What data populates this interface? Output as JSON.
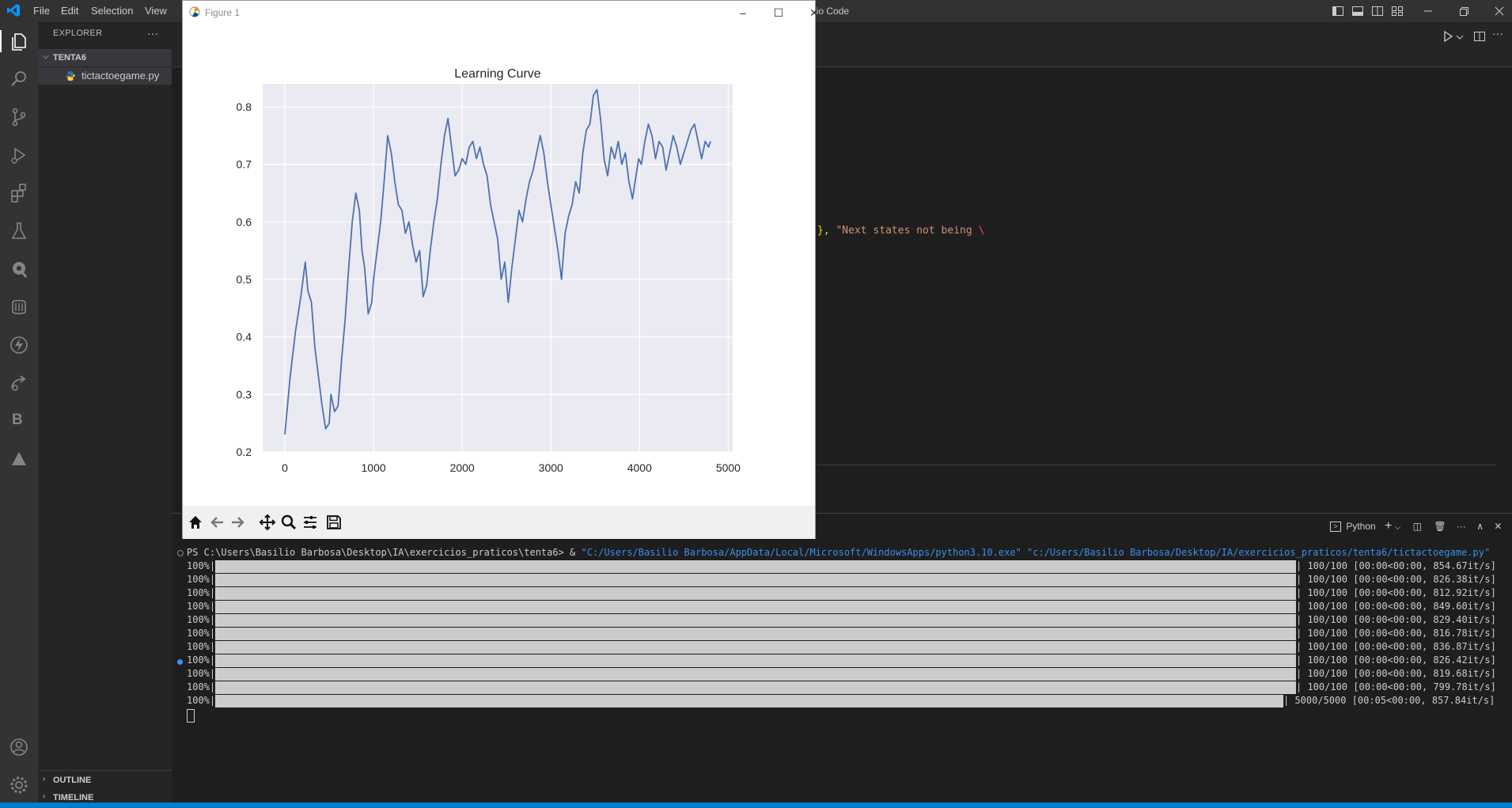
{
  "menu": {
    "file": "File",
    "edit": "Edit",
    "selection": "Selection",
    "view": "View"
  },
  "window": {
    "title_fragment": "dio Code"
  },
  "explorer": {
    "title": "EXPLORER",
    "more": "···",
    "folder": "TENTA6",
    "file": "tictactoegame.py",
    "outline": "OUTLINE",
    "timeline": "TIMELINE"
  },
  "editor": {
    "code_line_punct": "}, ",
    "code_line_string": "\"Next states not being ",
    "code_line_escape": "\\"
  },
  "panel": {
    "python_label": "Python"
  },
  "terminal": {
    "prompt": "PS C:\\Users\\Basilio Barbosa\\Desktop\\IA\\exercicios_praticos\\tenta6> & ",
    "cmd_exe": "\"C:/Users/Basilio Barbosa/AppData/Local/Microsoft/WindowsApps/python3.10.exe\"",
    "cmd_script": "\"c:/Users/Basilio Barbosa/Desktop/IA/exercicios_praticos/tenta6/tictactoegame.py\"",
    "progress": [
      {
        "pct": "100%|",
        "stat": "| 100/100 [00:00<00:00, 854.67it/s]"
      },
      {
        "pct": "100%|",
        "stat": "| 100/100 [00:00<00:00, 826.38it/s]"
      },
      {
        "pct": "100%|",
        "stat": "| 100/100 [00:00<00:00, 812.92it/s]"
      },
      {
        "pct": "100%|",
        "stat": "| 100/100 [00:00<00:00, 849.60it/s]"
      },
      {
        "pct": "100%|",
        "stat": "| 100/100 [00:00<00:00, 829.40it/s]"
      },
      {
        "pct": "100%|",
        "stat": "| 100/100 [00:00<00:00, 816.78it/s]"
      },
      {
        "pct": "100%|",
        "stat": "| 100/100 [00:00<00:00, 836.87it/s]"
      },
      {
        "pct": "100%|",
        "stat": "| 100/100 [00:00<00:00, 826.42it/s]"
      },
      {
        "pct": "100%|",
        "stat": "| 100/100 [00:00<00:00, 819.68it/s]"
      },
      {
        "pct": "100%|",
        "stat": "| 100/100 [00:00<00:00, 799.78it/s]"
      },
      {
        "pct": "100%|",
        "stat": "| 5000/5000 [00:05<00:00, 857.84it/s]"
      }
    ]
  },
  "figure": {
    "window_title": "Figure 1"
  },
  "chart_data": {
    "type": "line",
    "title": "Learning Curve",
    "xlabel": "",
    "ylabel": "",
    "xlim": [
      -250,
      5050
    ],
    "ylim": [
      0.2,
      0.84
    ],
    "xticks": [
      0,
      1000,
      2000,
      3000,
      4000,
      5000
    ],
    "yticks": [
      0.2,
      0.3,
      0.4,
      0.5,
      0.6,
      0.7,
      0.8
    ],
    "xtick_labels": [
      "0",
      "1000",
      "2000",
      "3000",
      "4000",
      "5000"
    ],
    "ytick_labels": [
      "0.2",
      "0.3",
      "0.4",
      "0.5",
      "0.6",
      "0.7",
      "0.8"
    ],
    "grid": true,
    "style": "seaborn-darkgrid",
    "color": "#4c72b0",
    "series": [
      {
        "x": [
          0,
          60,
          120,
          180,
          230,
          260,
          300,
          340,
          380,
          420,
          460,
          500,
          520,
          560,
          600,
          640,
          680,
          720,
          760,
          800,
          840,
          870,
          900,
          940,
          980,
          1000,
          1040,
          1080,
          1120,
          1160,
          1200,
          1240,
          1280,
          1320,
          1360,
          1400,
          1440,
          1480,
          1520,
          1560,
          1600,
          1640,
          1680,
          1720,
          1760,
          1800,
          1840,
          1880,
          1920,
          1960,
          2000,
          2040,
          2080,
          2120,
          2160,
          2200,
          2240,
          2280,
          2320,
          2360,
          2400,
          2440,
          2480,
          2520,
          2560,
          2600,
          2640,
          2680,
          2720,
          2760,
          2800,
          2840,
          2880,
          2920,
          2960,
          3000,
          3040,
          3080,
          3120,
          3160,
          3200,
          3240,
          3280,
          3320,
          3360,
          3400,
          3440,
          3480,
          3520,
          3560,
          3600,
          3640,
          3680,
          3720,
          3760,
          3800,
          3840,
          3880,
          3920,
          3960,
          3990,
          4020,
          4060,
          4100,
          4140,
          4180,
          4220,
          4260,
          4300,
          4340,
          4380,
          4420,
          4460,
          4500,
          4540,
          4580,
          4620,
          4660,
          4700,
          4740,
          4780,
          4800
        ],
        "y": [
          0.23,
          0.33,
          0.41,
          0.47,
          0.53,
          0.48,
          0.46,
          0.38,
          0.33,
          0.28,
          0.24,
          0.25,
          0.3,
          0.27,
          0.28,
          0.36,
          0.43,
          0.52,
          0.6,
          0.65,
          0.62,
          0.55,
          0.52,
          0.44,
          0.46,
          0.5,
          0.55,
          0.6,
          0.67,
          0.75,
          0.72,
          0.67,
          0.63,
          0.62,
          0.58,
          0.6,
          0.56,
          0.53,
          0.55,
          0.47,
          0.49,
          0.55,
          0.6,
          0.64,
          0.7,
          0.75,
          0.78,
          0.73,
          0.68,
          0.69,
          0.71,
          0.7,
          0.73,
          0.74,
          0.71,
          0.73,
          0.7,
          0.68,
          0.63,
          0.6,
          0.57,
          0.5,
          0.53,
          0.46,
          0.52,
          0.57,
          0.62,
          0.6,
          0.64,
          0.67,
          0.69,
          0.72,
          0.75,
          0.72,
          0.67,
          0.63,
          0.59,
          0.55,
          0.5,
          0.58,
          0.61,
          0.63,
          0.67,
          0.65,
          0.72,
          0.76,
          0.77,
          0.82,
          0.83,
          0.78,
          0.71,
          0.68,
          0.73,
          0.71,
          0.74,
          0.7,
          0.72,
          0.67,
          0.64,
          0.68,
          0.71,
          0.7,
          0.74,
          0.77,
          0.75,
          0.71,
          0.74,
          0.73,
          0.69,
          0.72,
          0.75,
          0.73,
          0.7,
          0.72,
          0.74,
          0.76,
          0.77,
          0.74,
          0.71,
          0.74,
          0.73,
          0.74
        ]
      }
    ]
  }
}
